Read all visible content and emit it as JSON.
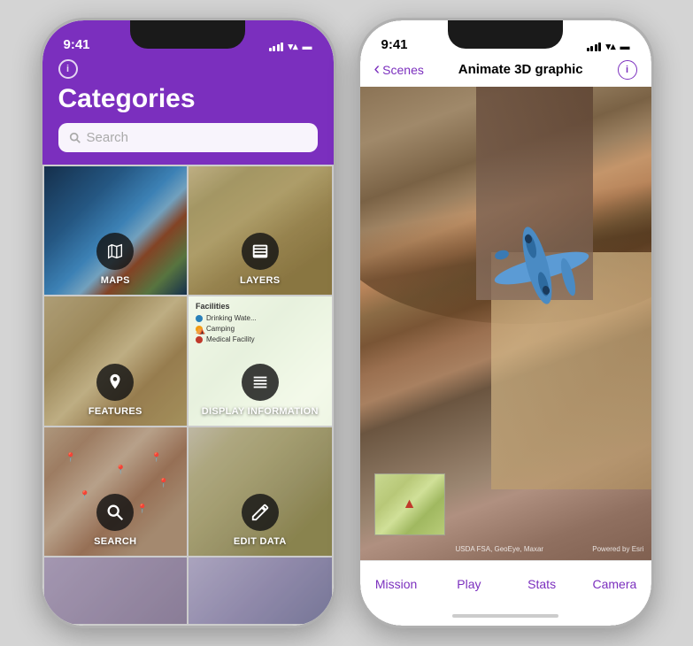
{
  "left_phone": {
    "status_time": "9:41",
    "header": {
      "title": "Categories",
      "search_placeholder": "Search"
    },
    "categories": [
      {
        "id": "maps",
        "label": "MAPS",
        "bg": "bg-maps",
        "icon": "map"
      },
      {
        "id": "layers",
        "label": "LAYERS",
        "bg": "bg-layers",
        "icon": "layers"
      },
      {
        "id": "features",
        "label": "FEATURES",
        "bg": "bg-features",
        "icon": "pin"
      },
      {
        "id": "display",
        "label": "DISPLAY INFORMATION",
        "bg": "bg-display",
        "icon": "list"
      },
      {
        "id": "search",
        "label": "SEARCH",
        "bg": "bg-search",
        "icon": "search"
      },
      {
        "id": "editdata",
        "label": "EDIT DATA",
        "bg": "bg-editdata",
        "icon": "pencil"
      },
      {
        "id": "partial1",
        "label": "",
        "bg": "bg-partial1",
        "icon": ""
      },
      {
        "id": "partial2",
        "label": "",
        "bg": "bg-partial2",
        "icon": ""
      }
    ],
    "display_info_items": [
      {
        "color": "#2980b9",
        "label": "Drinking Wate..."
      },
      {
        "color": "#27ae60",
        "label": "Camping"
      },
      {
        "color": "#c0392b",
        "label": "Medical Facility"
      }
    ]
  },
  "right_phone": {
    "status_time": "9:41",
    "header": {
      "back_label": "Scenes",
      "title": "Animate 3D graphic"
    },
    "attribution_left": "USDA FSA, GeoEye, Maxar",
    "attribution_right": "Powered by Esri",
    "tabs": [
      {
        "id": "mission",
        "label": "Mission"
      },
      {
        "id": "play",
        "label": "Play"
      },
      {
        "id": "stats",
        "label": "Stats"
      },
      {
        "id": "camera",
        "label": "Camera"
      }
    ]
  },
  "icons": {
    "search": "🔍",
    "info": "ⓘ",
    "back_chevron": "‹",
    "map_icon": "🗺",
    "layers_icon": "▤",
    "pin_icon": "📍",
    "list_icon": "≡",
    "pencil_icon": "✏",
    "wifi": "WiFi",
    "battery": "■"
  }
}
